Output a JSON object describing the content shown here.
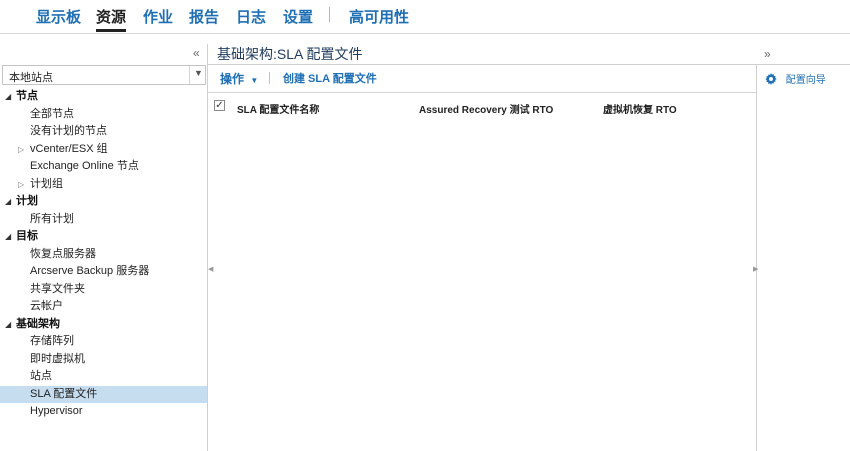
{
  "nav": {
    "items": [
      "显示板",
      "资源",
      "作业",
      "报告",
      "日志",
      "设置"
    ],
    "ha": "高可用性"
  },
  "left": {
    "site_value": "本地站点",
    "tree": {
      "nodes_header": "节点",
      "all_nodes": "全部节点",
      "unplanned_nodes": "没有计划的节点",
      "vcenter_group": "vCenter/ESX 组",
      "exchange_online": "Exchange Online 节点",
      "plan_group": "计划组",
      "plans_header": "计划",
      "all_plans": "所有计划",
      "targets_header": "目标",
      "recovery_point_server": "恢复点服务器",
      "arcserve_backup": "Arcserve Backup 服务器",
      "shared_folder": "共享文件夹",
      "cloud_account": "云帐户",
      "infra_header": "基础架构",
      "storage_array": "存储阵列",
      "instant_vm": "即时虚拟机",
      "sites": "站点",
      "sla_profile": "SLA 配置文件",
      "hypervisor": "Hypervisor"
    }
  },
  "main": {
    "title": "基础架构:SLA 配置文件",
    "toolbar": {
      "action": "操作",
      "create": "创建 SLA 配置文件"
    },
    "columns": [
      "SLA 配置文件名称",
      "Assured Recovery 测试 RTO",
      "虚拟机恢复 RTO"
    ]
  },
  "right": {
    "wizard": "配置向导"
  },
  "colors": {
    "accent": "#1f6fb5",
    "selected": "#c6dcef"
  }
}
